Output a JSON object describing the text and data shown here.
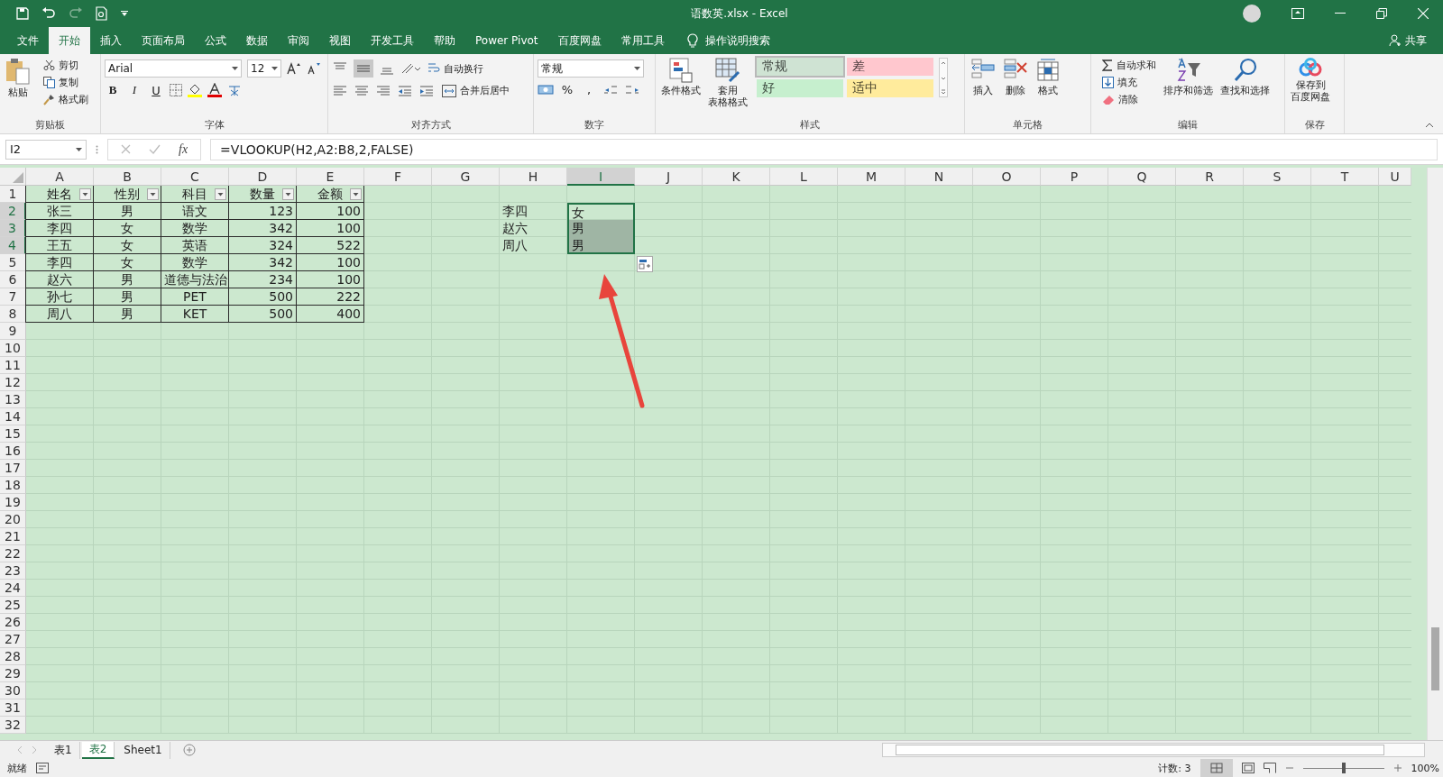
{
  "title_bar": {
    "title": "语数英.xlsx  -  Excel"
  },
  "ribbon_tabs": [
    {
      "label": "文件",
      "selected": false
    },
    {
      "label": "开始",
      "selected": true
    },
    {
      "label": "插入",
      "selected": false
    },
    {
      "label": "页面布局",
      "selected": false
    },
    {
      "label": "公式",
      "selected": false
    },
    {
      "label": "数据",
      "selected": false
    },
    {
      "label": "审阅",
      "selected": false
    },
    {
      "label": "视图",
      "selected": false
    },
    {
      "label": "开发工具",
      "selected": false
    },
    {
      "label": "帮助",
      "selected": false
    },
    {
      "label": "Power Pivot",
      "selected": false
    },
    {
      "label": "百度网盘",
      "selected": false
    },
    {
      "label": "常用工具",
      "selected": false
    }
  ],
  "tell_me": "操作说明搜索",
  "share": "共享",
  "ribbon": {
    "clipboard": {
      "label": "剪贴板",
      "paste": "粘贴",
      "items": [
        "剪切",
        "复制",
        "格式刷"
      ]
    },
    "font": {
      "label": "字体",
      "font_name": "Arial",
      "font_size": "12",
      "styles": [
        "B",
        "I",
        "U"
      ]
    },
    "alignment": {
      "label": "对齐方式",
      "wrap": "自动换行",
      "merge": "合并后居中"
    },
    "number": {
      "label": "数字",
      "format": "常规",
      "symbols": [
        "%",
        ","
      ]
    },
    "styles": {
      "label": "样式",
      "conditional": "条件格式",
      "table_format": [
        "套用",
        "表格格式"
      ],
      "cell_styles": [
        {
          "label": "常规",
          "color": "#cfe3d3"
        },
        {
          "label": "差",
          "color": "#ffc7ce"
        },
        {
          "label": "好",
          "color": "#c6efce"
        },
        {
          "label": "适中",
          "color": "#ffeb9c"
        }
      ]
    },
    "cells": {
      "label": "单元格",
      "items": [
        "插入",
        "删除",
        "格式"
      ]
    },
    "editing": {
      "label": "编辑",
      "items": [
        "自动求和",
        "填充",
        "清除"
      ],
      "sort": "排序和筛选",
      "find": "查找和选择"
    },
    "save": {
      "label": "保存",
      "button": [
        "保存到",
        "百度网盘"
      ]
    }
  },
  "formula_bar": {
    "name_box": "I2",
    "fx": "fx",
    "formula": "=VLOOKUP(H2,A2:B8,2,FALSE)"
  },
  "sheet": {
    "columns": [
      {
        "label": "A",
        "selected": false
      },
      {
        "label": "B",
        "selected": false
      },
      {
        "label": "C",
        "selected": false
      },
      {
        "label": "D",
        "selected": false
      },
      {
        "label": "E",
        "selected": false
      },
      {
        "label": "F",
        "selected": false
      },
      {
        "label": "G",
        "selected": false
      },
      {
        "label": "H",
        "selected": false
      },
      {
        "label": "I",
        "selected": true
      },
      {
        "label": "J",
        "selected": false
      },
      {
        "label": "K",
        "selected": false
      },
      {
        "label": "L",
        "selected": false
      },
      {
        "label": "M",
        "selected": false
      },
      {
        "label": "N",
        "selected": false
      },
      {
        "label": "O",
        "selected": false
      },
      {
        "label": "P",
        "selected": false
      },
      {
        "label": "Q",
        "selected": false
      },
      {
        "label": "R",
        "selected": false
      },
      {
        "label": "S",
        "selected": false
      },
      {
        "label": "T",
        "selected": false
      },
      {
        "label": "U",
        "selected": false
      }
    ],
    "rows": [
      {
        "header": "1",
        "selected": false,
        "filter": true,
        "cells": {
          "A": "姓名",
          "B": "性别",
          "C": "科目",
          "D": "数量",
          "E": "金额"
        }
      },
      {
        "header": "2",
        "selected": true,
        "cells": {
          "A": "张三",
          "B": "男",
          "C": "语文",
          "D": "123",
          "E": "100",
          "H": "李四",
          "I": "女"
        }
      },
      {
        "header": "3",
        "selected": true,
        "cells": {
          "A": "李四",
          "B": "女",
          "C": "数学",
          "D": "342",
          "E": "100",
          "H": "赵六",
          "I": "男"
        }
      },
      {
        "header": "4",
        "selected": true,
        "cells": {
          "A": "王五",
          "B": "女",
          "C": "英语",
          "D": "324",
          "E": "522",
          "H": "周八",
          "I": "男"
        }
      },
      {
        "header": "5",
        "selected": false,
        "cells": {
          "A": "李四",
          "B": "女",
          "C": "数学",
          "D": "342",
          "E": "100"
        }
      },
      {
        "header": "6",
        "selected": false,
        "cells": {
          "A": "赵六",
          "B": "男",
          "C": "道德与法治",
          "D": "234",
          "E": "100"
        }
      },
      {
        "header": "7",
        "selected": false,
        "cells": {
          "A": "孙七",
          "B": "男",
          "C": "PET",
          "D": "500",
          "E": "222"
        }
      },
      {
        "header": "8",
        "selected": false,
        "cells": {
          "A": "周八",
          "B": "男",
          "C": "KET",
          "D": "500",
          "E": "400"
        }
      },
      {
        "header": "9",
        "selected": false,
        "cells": {}
      },
      {
        "header": "10",
        "selected": false,
        "cells": {}
      },
      {
        "header": "11",
        "selected": false,
        "cells": {}
      },
      {
        "header": "12",
        "selected": false,
        "cells": {}
      },
      {
        "header": "13",
        "selected": false,
        "cells": {}
      },
      {
        "header": "14",
        "selected": false,
        "cells": {}
      },
      {
        "header": "15",
        "selected": false,
        "cells": {}
      },
      {
        "header": "16",
        "selected": false,
        "cells": {}
      },
      {
        "header": "17",
        "selected": false,
        "cells": {}
      },
      {
        "header": "18",
        "selected": false,
        "cells": {}
      },
      {
        "header": "19",
        "selected": false,
        "cells": {}
      },
      {
        "header": "20",
        "selected": false,
        "cells": {}
      },
      {
        "header": "21",
        "selected": false,
        "cells": {}
      },
      {
        "header": "22",
        "selected": false,
        "cells": {}
      },
      {
        "header": "23",
        "selected": false,
        "cells": {}
      },
      {
        "header": "24",
        "selected": false,
        "cells": {}
      },
      {
        "header": "25",
        "selected": false,
        "cells": {}
      },
      {
        "header": "26",
        "selected": false,
        "cells": {}
      },
      {
        "header": "27",
        "selected": false,
        "cells": {}
      },
      {
        "header": "28",
        "selected": false,
        "cells": {}
      },
      {
        "header": "29",
        "selected": false,
        "cells": {}
      },
      {
        "header": "30",
        "selected": false,
        "cells": {}
      },
      {
        "header": "31",
        "selected": false,
        "cells": {}
      },
      {
        "header": "32",
        "selected": false,
        "cells": {}
      }
    ]
  },
  "sheet_tabs": [
    {
      "label": "表1",
      "selected": false
    },
    {
      "label": "表2",
      "selected": true
    },
    {
      "label": "Sheet1",
      "selected": false
    }
  ],
  "status_bar": {
    "status": "就绪",
    "count": "计数: 3",
    "zoom": {
      "level": 0.5
    },
    "zoom_label": "100%"
  }
}
